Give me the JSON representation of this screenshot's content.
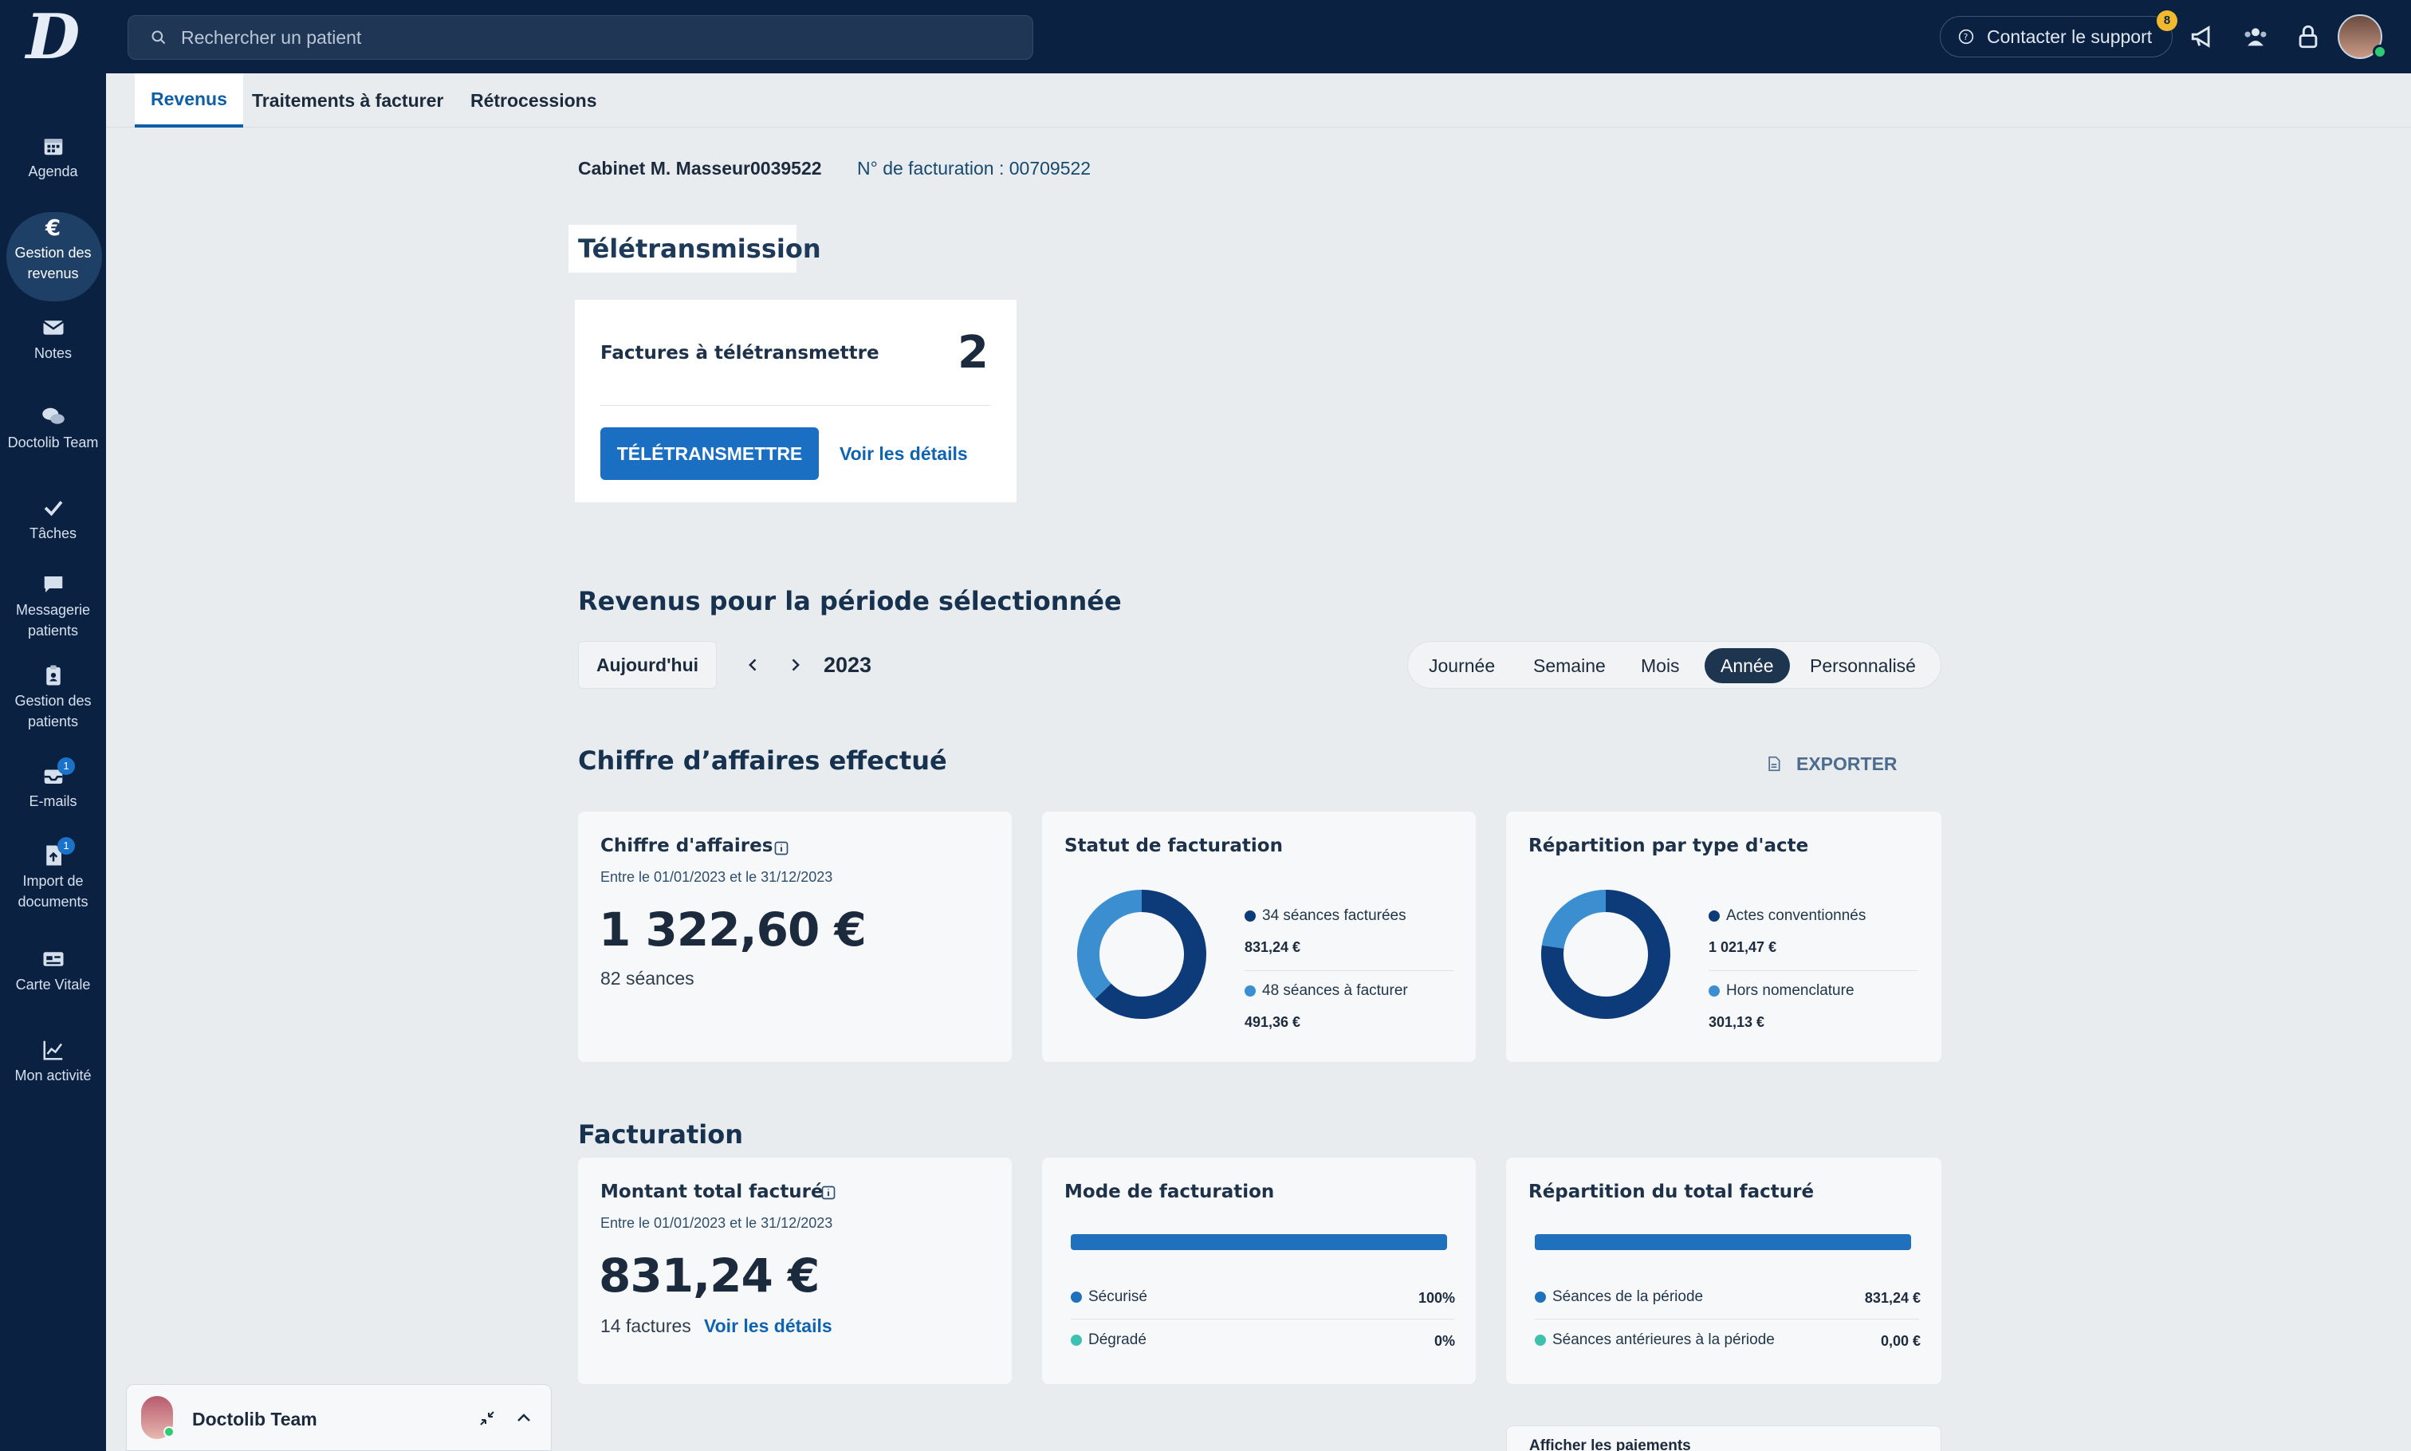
{
  "sidebar": {
    "logo": "D",
    "items": [
      {
        "label": "Agenda",
        "icon": "calendar-icon"
      },
      {
        "label": "Gestion des revenus",
        "icon": "euro-icon"
      },
      {
        "label": "Notes",
        "icon": "envelope-icon"
      },
      {
        "label": "Doctolib Team",
        "icon": "chat-bubbles-icon"
      },
      {
        "label": "Tâches",
        "icon": "check-icon"
      },
      {
        "label": "Messagerie patients",
        "icon": "message-icon"
      },
      {
        "label": "Gestion des patients",
        "icon": "clipboard-icon"
      },
      {
        "label": "E-mails",
        "icon": "inbox-icon",
        "badge": "1"
      },
      {
        "label": "Import de documents",
        "icon": "upload-document-icon",
        "badge": "1"
      },
      {
        "label": "Carte Vitale",
        "icon": "card-icon"
      },
      {
        "label": "Mon activité",
        "icon": "chart-line-icon"
      }
    ]
  },
  "topbar": {
    "search_placeholder": "Rechercher un patient",
    "support_label": "Contacter le support",
    "support_badge": "8"
  },
  "tabs": [
    {
      "label": "Revenus",
      "active": true
    },
    {
      "label": "Traitements à facturer"
    },
    {
      "label": "Rétrocessions"
    }
  ],
  "header": {
    "cabinet": "Cabinet M. Masseur0039522",
    "billing_number": "N° de facturation : 00709522"
  },
  "teletransmission": {
    "title": "Télétransmission",
    "invoices_label": "Factures à télétransmettre",
    "invoices_count": "2",
    "button_label": "TÉLÉTRANSMETTRE",
    "details_link": "Voir les détails"
  },
  "period": {
    "title": "Revenus pour la période sélectionnée",
    "today_label": "Aujourd'hui",
    "year": "2023",
    "options": [
      "Journée",
      "Semaine",
      "Mois",
      "Année",
      "Personnalisé"
    ],
    "selected": "Année"
  },
  "revenue": {
    "title": "Chiffre d’affaires effectué",
    "export_label": "EXPORTER",
    "card_ca": {
      "title": "Chiffre d'affaires",
      "range": "Entre le 01/01/2023 et le 31/12/2023",
      "amount": "1 322,60 €",
      "sessions": "82 séances"
    },
    "card_status": {
      "title": "Statut de facturation",
      "items": [
        {
          "label": "34 séances facturées",
          "value": "831,24 €",
          "color": "#0d3a78",
          "share": 0.6285
        },
        {
          "label": "48 séances à facturer",
          "value": "491,36 €",
          "color": "#3b8fd0",
          "share": 0.3715
        }
      ]
    },
    "card_type": {
      "title": "Répartition par type d'acte",
      "items": [
        {
          "label": "Actes conventionnés",
          "value": "1 021,47 €",
          "color": "#0d3a78",
          "share": 0.7723
        },
        {
          "label": "Hors nomenclature",
          "value": "301,13 €",
          "color": "#3b8fd0",
          "share": 0.2277
        }
      ]
    }
  },
  "billing": {
    "title": "Facturation",
    "card_total": {
      "title": "Montant total facturé",
      "range": "Entre le 01/01/2023 et le 31/12/2023",
      "amount": "831,24 €",
      "invoices": "14 factures",
      "details_link": "Voir les détails"
    },
    "card_mode": {
      "title": "Mode de facturation",
      "bar_fraction": 1.0,
      "items": [
        {
          "label": "Sécurisé",
          "value": "100%",
          "color": "#1f70bd"
        },
        {
          "label": "Dégradé",
          "value": "0%",
          "color": "#3ec2b0"
        }
      ]
    },
    "card_split": {
      "title": "Répartition du total facturé",
      "bar_fraction": 1.0,
      "items": [
        {
          "label": "Séances de la période",
          "value": "831,24 €",
          "color": "#1f70bd"
        },
        {
          "label": "Séances antérieures à la période",
          "value": "0,00 €",
          "color": "#3ec2b0"
        }
      ]
    },
    "payments_label": "Afficher les paiements"
  },
  "chat": {
    "label": "Doctolib Team"
  }
}
